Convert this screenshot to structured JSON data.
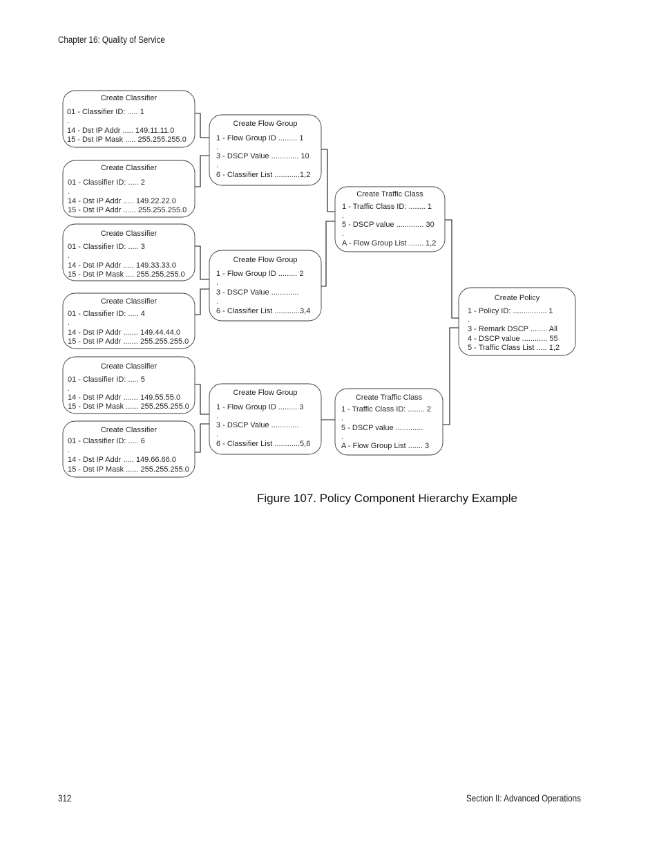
{
  "page": {
    "running_head": "Chapter 16: Quality of Service",
    "page_number": "312",
    "section_footer": "Section II: Advanced Operations",
    "figure_caption": "Figure 107. Policy Component Hierarchy Example"
  },
  "diagram": {
    "classifiers": [
      {
        "id": "classifier-1",
        "title": "Create Classifier",
        "lines": [
          "01 - Classifier ID: ..... 1",
          ".",
          "14 - Dst IP Addr  ..... 149.11.11.0",
          "15 - Dst IP Mask ..... 255.255.255.0"
        ]
      },
      {
        "id": "classifier-2",
        "title": "Create Classifier",
        "lines": [
          "01 - Classifier ID: ..... 2",
          ".",
          "14 - Dst IP Addr  ..... 149.22.22.0",
          "15 - Dst IP Addr ...... 255.255.255.0"
        ]
      },
      {
        "id": "classifier-3",
        "title": "Create Classifier",
        "lines": [
          "01 - Classifier ID: ..... 3",
          ".",
          "14 - Dst IP Addr ..... 149.33.33.0",
          "15 - Dst IP Mask .... 255.255.255.0"
        ]
      },
      {
        "id": "classifier-4",
        "title": "Create Classifier",
        "lines": [
          "01 - Classifier ID: ..... 4",
          ".",
          "14 - Dst IP Addr ....... 149.44.44.0",
          "15 - Dst IP Addr ....... 255.255.255.0"
        ]
      },
      {
        "id": "classifier-5",
        "title": "Create Classifier",
        "lines": [
          "01 - Classifier ID: ..... 5",
          ".",
          "14 - Dst IP Addr ....... 149.55.55.0",
          "15 - Dst IP Mask ...... 255.255.255.0"
        ]
      },
      {
        "id": "classifier-6",
        "title": "Create Classifier",
        "lines": [
          "01 - Classifier ID: ..... 6",
          ".",
          "14 - Dst IP Addr ..... 149.66.66.0",
          "15 - Dst IP Mask ...... 255.255.255.0"
        ]
      }
    ],
    "flow_groups": [
      {
        "id": "flow-group-1",
        "title": "Create Flow Group",
        "lines": [
          "1 - Flow Group ID ......... 1",
          ".",
          "3 - DSCP Value ............. 10",
          ".",
          "6 - Classifier List ............1,2"
        ]
      },
      {
        "id": "flow-group-2",
        "title": "Create Flow Group",
        "lines": [
          "1 - Flow Group ID ......... 2",
          ".",
          "3 - DSCP Value .............",
          ".",
          "6 - Classifier List ............3,4"
        ]
      },
      {
        "id": "flow-group-3",
        "title": "Create Flow Group",
        "lines": [
          "1 - Flow Group ID ......... 3",
          ".",
          "3 - DSCP Value .............",
          ".",
          "6 - Classifier List ............5,6"
        ]
      }
    ],
    "traffic_classes": [
      {
        "id": "traffic-class-1",
        "title": "Create Traffic Class",
        "lines": [
          "1 - Traffic Class ID: ........ 1",
          ".",
          "5 - DSCP value ............. 30",
          ".",
          "A - Flow Group List ....... 1,2"
        ]
      },
      {
        "id": "traffic-class-2",
        "title": "Create Traffic Class",
        "lines": [
          "1 - Traffic Class ID: ........ 2",
          ".",
          "5 - DSCP value .............",
          ".",
          "A - Flow Group List ....... 3"
        ]
      }
    ],
    "policy": {
      "id": "policy-1",
      "title": "Create Policy",
      "lines": [
        "1 - Policy ID: ................ 1",
        ".",
        "3 - Remark DSCP ........ All",
        "4 - DSCP value ............ 55",
        "5 - Traffic Class List ..... 1,2"
      ]
    },
    "links": [
      {
        "from": "classifier-1",
        "to": "flow-group-1"
      },
      {
        "from": "classifier-2",
        "to": "flow-group-1"
      },
      {
        "from": "classifier-3",
        "to": "flow-group-2"
      },
      {
        "from": "classifier-4",
        "to": "flow-group-2"
      },
      {
        "from": "classifier-5",
        "to": "flow-group-3"
      },
      {
        "from": "classifier-6",
        "to": "flow-group-3"
      },
      {
        "from": "flow-group-1",
        "to": "traffic-class-1"
      },
      {
        "from": "flow-group-2",
        "to": "traffic-class-1"
      },
      {
        "from": "flow-group-3",
        "to": "traffic-class-2"
      },
      {
        "from": "traffic-class-1",
        "to": "policy-1"
      },
      {
        "from": "traffic-class-2",
        "to": "policy-1"
      }
    ]
  }
}
